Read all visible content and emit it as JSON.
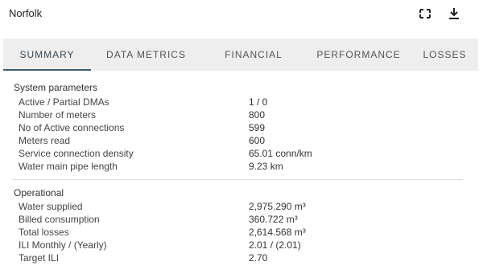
{
  "header": {
    "title": "Norfolk"
  },
  "icons": {
    "fullscreen": "fullscreen-icon",
    "download": "download-icon"
  },
  "tabs": [
    {
      "label": "SUMMARY",
      "active": true
    },
    {
      "label": "DATA METRICS",
      "active": false
    },
    {
      "label": "FINANCIAL",
      "active": false
    },
    {
      "label": "PERFORMANCE",
      "active": false
    },
    {
      "label": "LOSSES",
      "active": false
    }
  ],
  "system": {
    "title": "System parameters",
    "rows": [
      {
        "label": "Active / Partial DMAs",
        "value": "1 / 0"
      },
      {
        "label": "Number of meters",
        "value": "800"
      },
      {
        "label": "No of Active connections",
        "value": "599"
      },
      {
        "label": "Meters read",
        "value": "600"
      },
      {
        "label": "Service connection density",
        "value": "65.01 conn/km"
      },
      {
        "label": "Water main pipe length",
        "value": "9.23 km"
      }
    ]
  },
  "operational": {
    "title": "Operational",
    "rows": [
      {
        "label": "Water supplied",
        "value": "2,975.290 m³"
      },
      {
        "label": "Billed consumption",
        "value": "360.722 m³"
      },
      {
        "label": "Total losses",
        "value": "2,614.568 m³"
      },
      {
        "label": "ILI Monthly / (Yearly)",
        "value": "2.01 / (2.01)"
      },
      {
        "label": "Target ILI",
        "value": "2.70"
      }
    ]
  },
  "colors": {
    "tab_bg": "#eeeeee",
    "active_underline": "#3d5f74",
    "divider": "#dddddd"
  }
}
